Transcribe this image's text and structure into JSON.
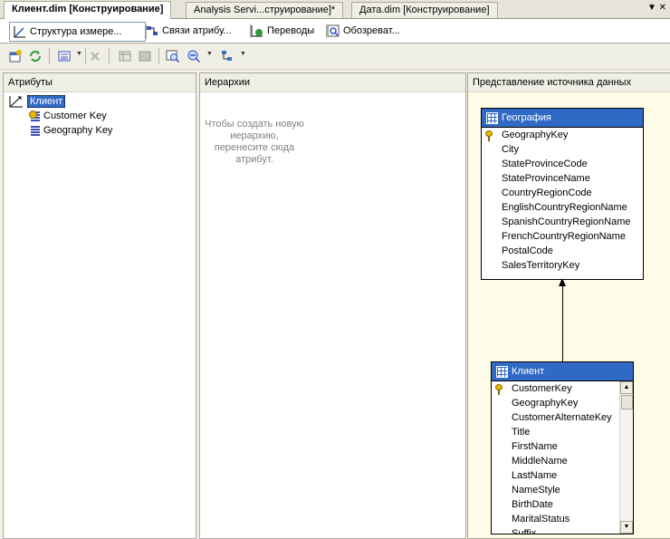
{
  "doc_tabs": [
    {
      "label": "Клиент.dim [Конструирование]",
      "active": true
    },
    {
      "label": "Analysis Servi...струирование]*",
      "active": false
    },
    {
      "label": "Дата.dim [Конструирование]",
      "active": false
    }
  ],
  "window_controls": "▼ ✕",
  "designer_tabs": [
    {
      "label": "Структура измере...",
      "icon": "dimension-structure-icon",
      "active": true
    },
    {
      "label": "Связи атрибу...",
      "icon": "attribute-relationships-icon",
      "active": false
    },
    {
      "label": "Переводы",
      "icon": "translations-icon",
      "active": false
    },
    {
      "label": "Обозреват...",
      "icon": "browser-icon",
      "active": false
    }
  ],
  "panes": {
    "attributes": {
      "title": "Атрибуты",
      "root": "Клиент",
      "items": [
        "Customer Key",
        "Geography Key"
      ]
    },
    "hierarchies": {
      "title": "Иерархии",
      "hint": "Чтобы создать новую иерархию, перенесите сюда атрибут."
    },
    "dsv": {
      "title": "Представление источника данных",
      "tables": [
        {
          "name": "География",
          "columns": [
            "GeographyKey",
            "City",
            "StateProvinceCode",
            "StateProvinceName",
            "CountryRegionCode",
            "EnglishCountryRegionName",
            "SpanishCountryRegionName",
            "FrenchCountryRegionName",
            "PostalCode",
            "SalesTerritoryKey"
          ]
        },
        {
          "name": "Клиент",
          "columns": [
            "CustomerKey",
            "GeographyKey",
            "CustomerAlternateKey",
            "Title",
            "FirstName",
            "MiddleName",
            "LastName",
            "NameStyle",
            "BirthDate",
            "MaritalStatus",
            "Suffix"
          ]
        }
      ]
    }
  },
  "colors": {
    "selection": "#316ac5",
    "dsv_background": "#fefbe7"
  }
}
